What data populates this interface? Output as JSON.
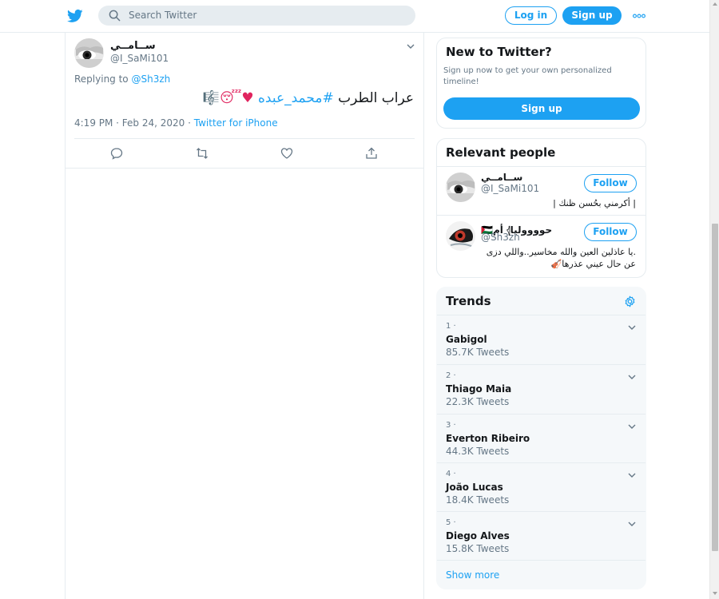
{
  "brand": {
    "logo_icon": "twitter-bird-icon",
    "accent": "#1da1f2"
  },
  "header": {
    "search_placeholder": "Search Twitter",
    "login_label": "Log in",
    "signup_label": "Sign up",
    "more_icon": "more-dots-icon"
  },
  "tweet": {
    "author_name": "ســامــي",
    "author_handle": "@I_SaMi101",
    "replying_prefix": "Replying to",
    "replying_to": "@Sh3zh",
    "text_plain": "عراب الطرب",
    "hashtag": "#محمد_عبده",
    "text_emoji": "♥😴🎼",
    "timestamp": "4:19 PM · Feb 24, 2020",
    "separator": " · ",
    "source": "Twitter for iPhone",
    "actions": [
      "reply-icon",
      "retweet-icon",
      "like-icon",
      "share-icon"
    ]
  },
  "new_to_twitter": {
    "title": "New to Twitter?",
    "subtitle": "Sign up now to get your own personalized timeline!",
    "signup_label": "Sign up"
  },
  "relevant_people": {
    "title": "Relevant people",
    "people": [
      {
        "name": "ســامــي",
        "handle": "@I_SaMi101",
        "follow_label": "Follow",
        "bio_line1": "| أكرمني بحُسن ظنك |",
        "bio_line2": ""
      },
      {
        "name": "🇵🇸أم 𓂆حووووليا",
        "handle": "@Sh3zh",
        "follow_label": "Follow",
        "bio_line1": ".يا عاذلين العين والله مخاسير..واللي دزى",
        "bio_line2": "عن حال عيني عذرها🎻"
      }
    ]
  },
  "trends": {
    "title": "Trends",
    "settings_icon": "gear-icon",
    "items": [
      {
        "rank": "1 ·",
        "name": "Gabigol",
        "count": "85.7K Tweets"
      },
      {
        "rank": "2 ·",
        "name": "Thiago Maia",
        "count": "22.3K Tweets"
      },
      {
        "rank": "3 ·",
        "name": "Everton Ribeiro",
        "count": "44.3K Tweets"
      },
      {
        "rank": "4 ·",
        "name": "João Lucas",
        "count": "18.4K Tweets"
      },
      {
        "rank": "5 ·",
        "name": "Diego Alves",
        "count": "15.8K Tweets"
      }
    ],
    "show_more_label": "Show more"
  }
}
